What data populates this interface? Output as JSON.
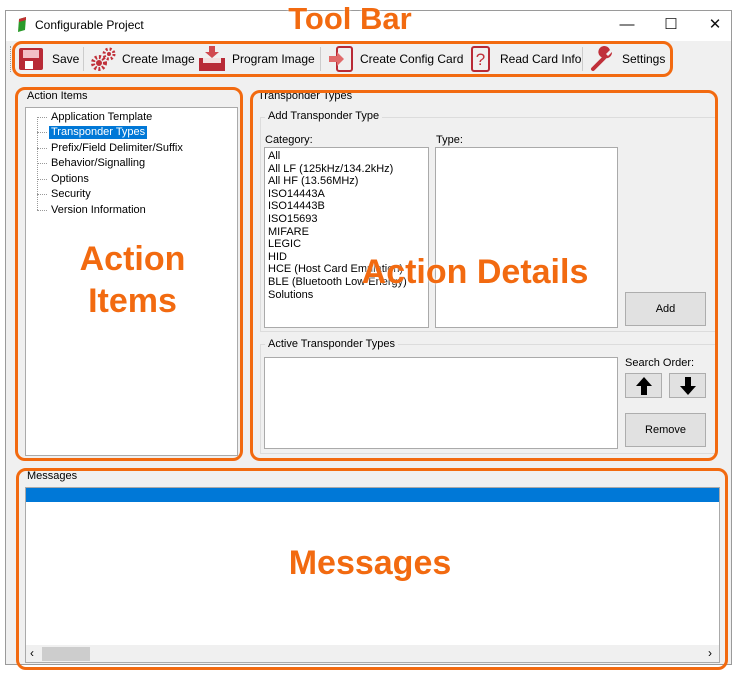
{
  "window": {
    "title": "Configurable Project",
    "minimize": "—",
    "maximize": "☐",
    "close": "✕"
  },
  "toolbar": {
    "items": [
      {
        "label": "Save",
        "icon": "save-icon"
      },
      {
        "label": "Create Image",
        "icon": "gears-icon"
      },
      {
        "label": "Program Image",
        "icon": "program-icon"
      },
      {
        "label": "Create Config Card",
        "icon": "config-card-icon"
      },
      {
        "label": "Read Card Info",
        "icon": "question-card-icon"
      },
      {
        "label": "Settings",
        "icon": "wrench-icon"
      }
    ]
  },
  "action_items": {
    "label": "Action Items",
    "tree": [
      "Application Template",
      "Transponder Types",
      "Prefix/Field Delimiter/Suffix",
      "Behavior/Signalling",
      "Options",
      "Security",
      "Version Information"
    ],
    "selected": "Transponder Types"
  },
  "details": {
    "label": "Transponder Types",
    "add_group": "Add Transponder Type",
    "category_label": "Category:",
    "type_label": "Type:",
    "categories": [
      "All",
      "All LF (125kHz/134.2kHz)",
      "All HF (13.56MHz)",
      "ISO14443A",
      "ISO14443B",
      "ISO15693",
      "MIFARE",
      "LEGIC",
      "HID",
      "HCE (Host Card Emulation)",
      "BLE (Bluetooth Low Energy)",
      "Solutions"
    ],
    "add_button": "Add",
    "active_group": "Active Transponder Types",
    "search_order": "Search Order:",
    "remove_button": "Remove"
  },
  "messages": {
    "label": "Messages"
  },
  "annotations": {
    "toolbar": "Tool Bar",
    "action_items": "Action\nItems",
    "action_details": "Action Details",
    "messages": "Messages"
  },
  "colors": {
    "accent": "#f26a10",
    "selection": "#0078d7",
    "icon_red": "#c0303a"
  }
}
